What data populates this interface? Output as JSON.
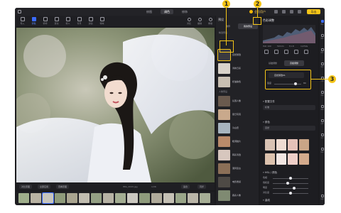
{
  "titlebar": {
    "tabs": [
      "修图",
      "调色",
      "修饰"
    ],
    "active_tab": 1,
    "user_label": "会员用户",
    "export_label": "导出"
  },
  "toolbar": {
    "tools": [
      "导入",
      "调色",
      "修饰",
      "液化",
      "修人",
      "背景",
      "滤镜",
      "特效"
    ],
    "right_buttons": [
      "对比",
      "撤销",
      "重做"
    ]
  },
  "presets_panel": {
    "title": "预设",
    "tabs": [
      "推荐",
      "我的预设"
    ],
    "section_labels": [
      "精选预设",
      "人像预设"
    ],
    "cards": [
      "自然通透",
      "清新日系",
      "奶油肤色",
      "氛围人像",
      "夏日写真",
      "冷白皮",
      "暖调胶片",
      "韩系清透",
      "港风复古",
      "电影质感",
      "森系人像",
      "黑白经典"
    ],
    "selected_index": 0
  },
  "adjust_panel": {
    "title": "色彩调整",
    "hist_stats": [
      "ISO 100",
      "50mm",
      "f/1.8",
      "1/250s"
    ],
    "tabs": [
      "基础调整",
      "高级调整"
    ],
    "preset_name": "自然通透01",
    "intensity_label": "强度",
    "intensity_value": 80,
    "section_labels": [
      "配置文件",
      "肤色",
      "HSL / 颜色",
      "曲线"
    ],
    "profile_value": "标准",
    "skin_tone_value": "自然",
    "face_labels": [
      "原图",
      "白皙",
      "红润",
      "小麦",
      "自然",
      "冷白",
      "粉嫩",
      "健康"
    ],
    "hsl_rows": [
      {
        "label": "色相",
        "value": 0.5
      },
      {
        "label": "饱和度",
        "value": 0.42
      },
      {
        "label": "明度",
        "value": 0.6
      },
      {
        "label": "对比度",
        "value": 0.5
      }
    ]
  },
  "right_strip": [
    "预设",
    "调色",
    "修饰",
    "液化",
    "人像",
    "背景",
    "滤镜",
    "边框",
    "文字",
    "贴纸",
    "设置"
  ],
  "bottombar": {
    "buttons": [
      "对比原图",
      "全部应用",
      "查看原图"
    ],
    "filename": "IMG_2043.jpg",
    "count": "1/36",
    "right_buttons": [
      "适合",
      "同步"
    ]
  },
  "callouts": [
    "1",
    "2",
    "3"
  ],
  "colors": {
    "accent": "#3b6cff",
    "highlight": "#f5c518",
    "app_bg": "#1b1b1e"
  }
}
